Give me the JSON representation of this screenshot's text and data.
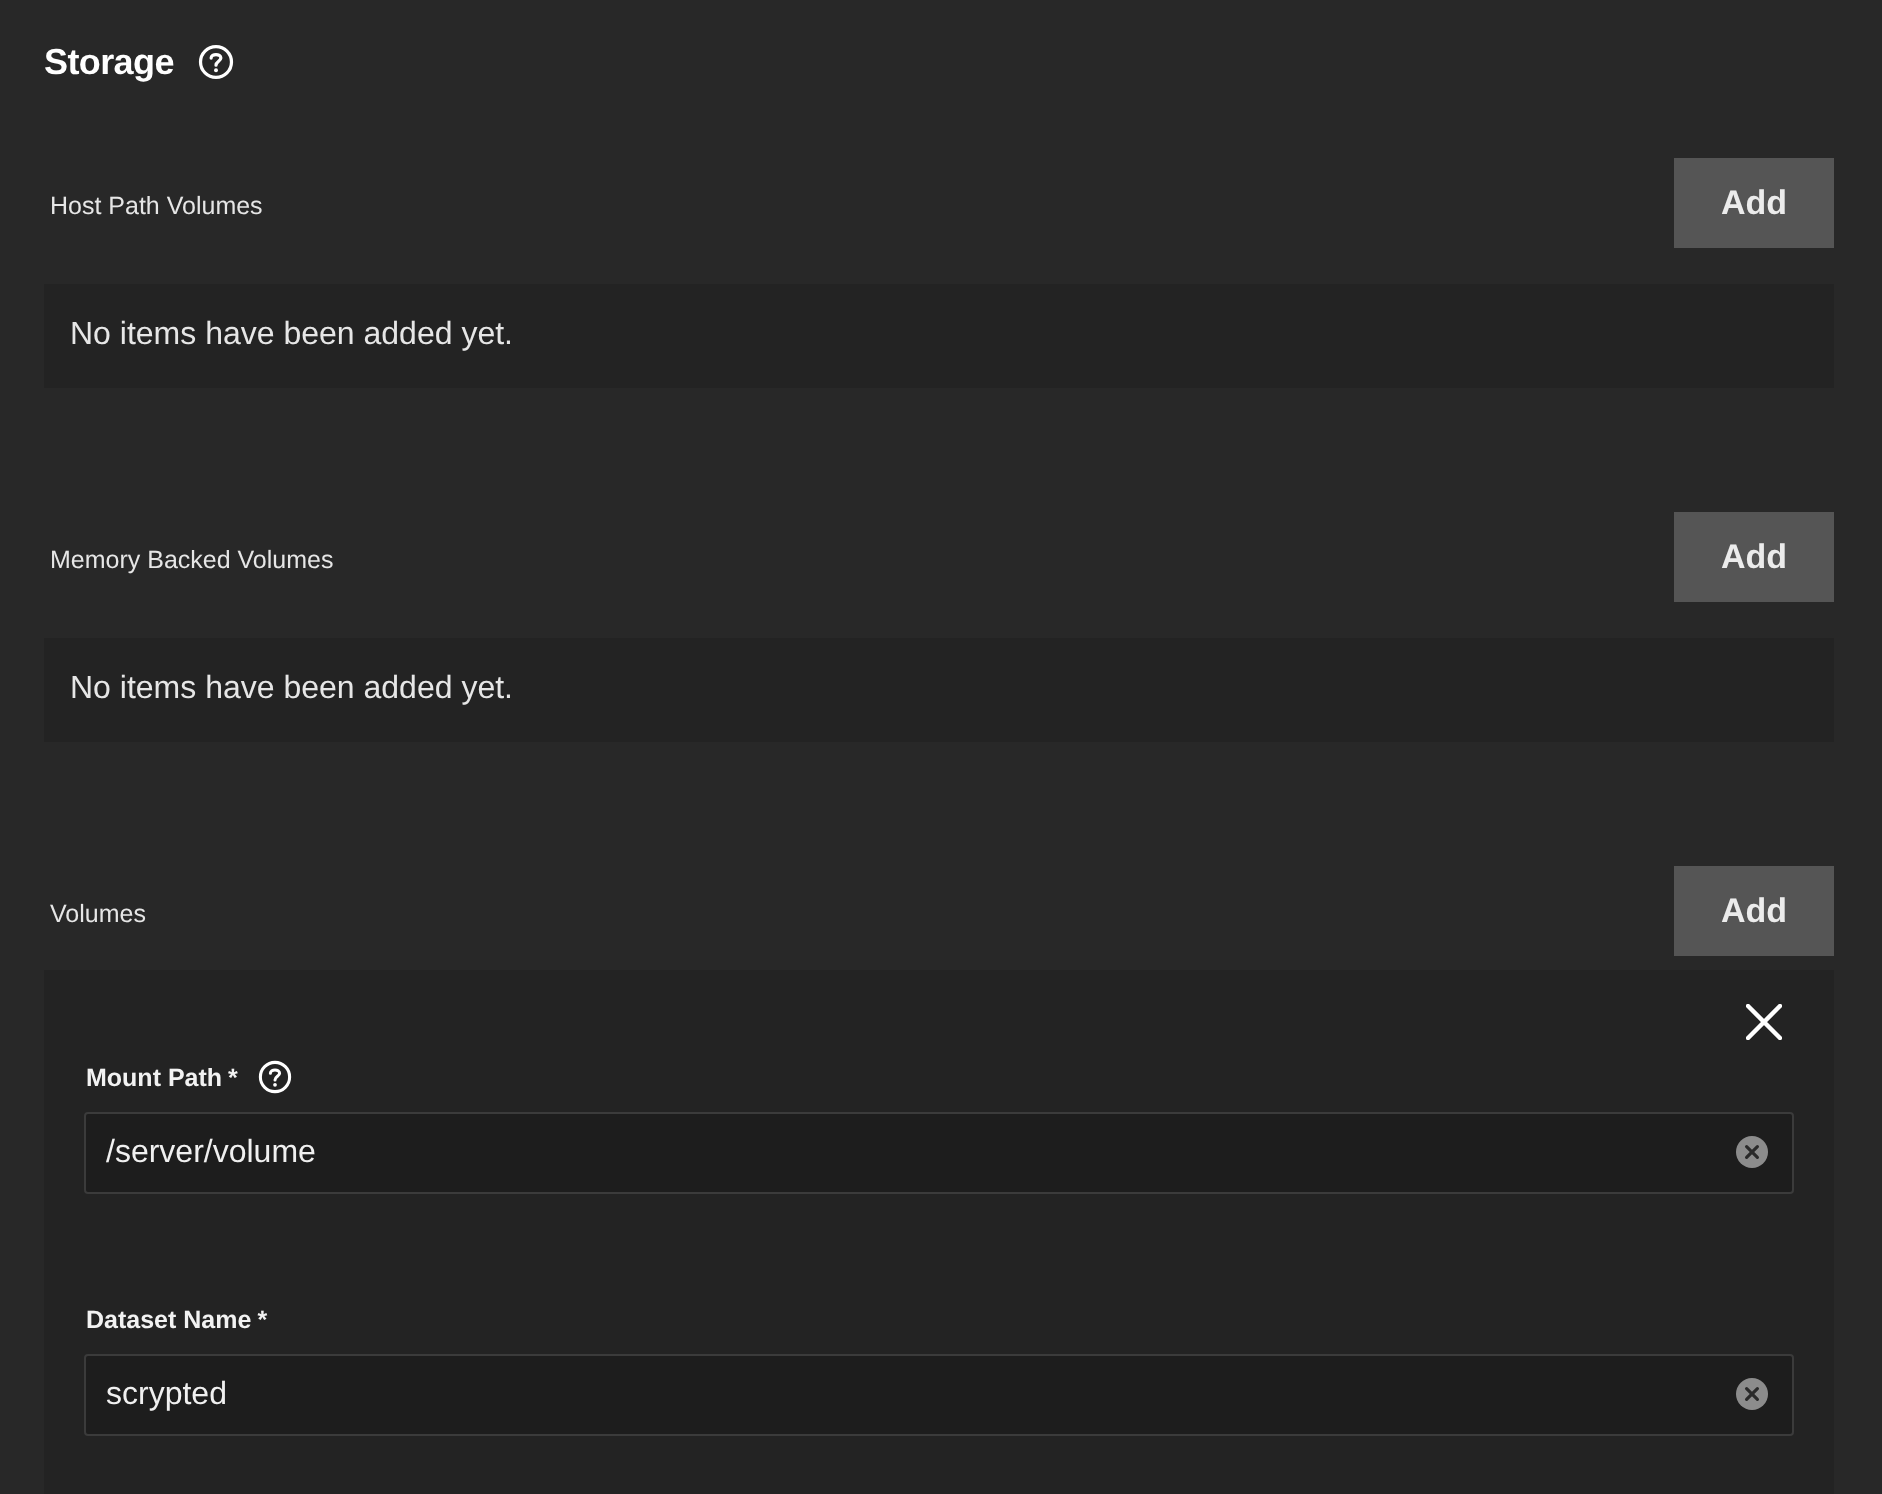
{
  "title": "Storage",
  "sections": [
    {
      "label": "Host Path Volumes",
      "add_button": "Add",
      "kind": "empty",
      "empty_text": "No items have been added yet."
    },
    {
      "label": "Memory Backed Volumes",
      "add_button": "Add",
      "kind": "empty",
      "empty_text": "No items have been added yet."
    },
    {
      "label": "Volumes",
      "add_button": "Add",
      "kind": "items",
      "items": [
        {
          "fields": [
            {
              "label": "Mount Path",
              "required_mark": "*",
              "help": true,
              "value": "/server/volume"
            },
            {
              "label": "Dataset Name",
              "required_mark": "*",
              "help": false,
              "value": "scrypted"
            }
          ]
        }
      ]
    }
  ]
}
